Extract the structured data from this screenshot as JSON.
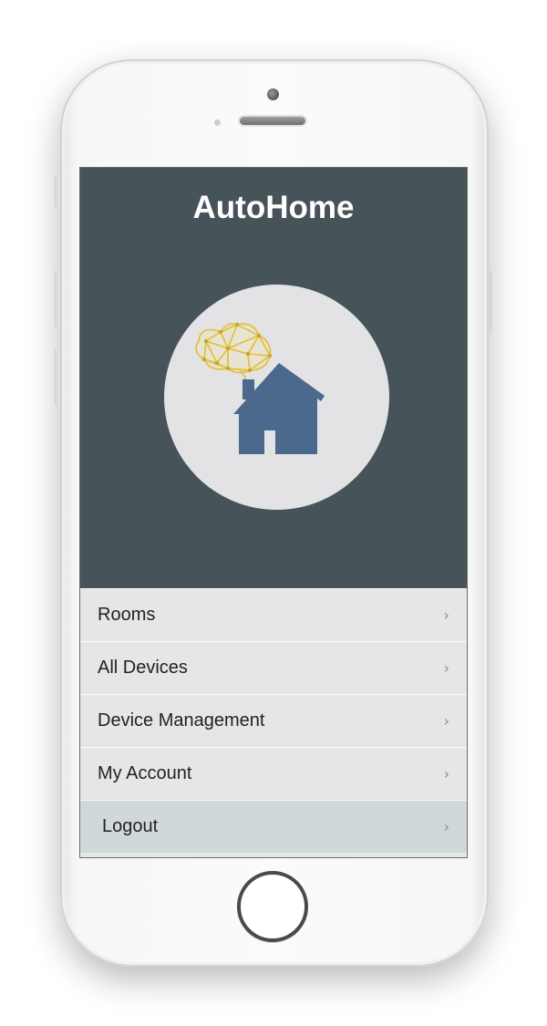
{
  "app": {
    "title": "AutoHome"
  },
  "logo": {
    "icon": "brain-house-logo-icon",
    "colors": {
      "house": "#4a698d",
      "brain": "#e7c84a",
      "circle": "#e3e3e6"
    }
  },
  "header": {
    "background": "#465358"
  },
  "menu": {
    "items": [
      {
        "label": "Rooms",
        "chevron": "›"
      },
      {
        "label": "All Devices",
        "chevron": "›"
      },
      {
        "label": "Device Management",
        "chevron": "›"
      },
      {
        "label": "My Account",
        "chevron": "›"
      },
      {
        "label": "Logout",
        "chevron": "›",
        "active": true
      }
    ]
  }
}
